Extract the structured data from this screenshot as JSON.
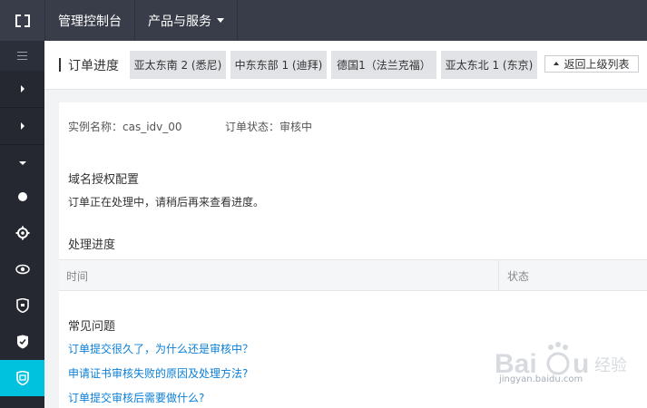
{
  "topbar": {
    "console_label": "管理控制台",
    "products_label": "产品与服务"
  },
  "sidebar": {
    "icons": [
      "menu-icon",
      "chevron-right-icon",
      "chevron-right-icon",
      "chevron-down-icon",
      "circle-icon",
      "gear-icon",
      "eye-icon",
      "shield-icon",
      "shield-check-icon",
      "certificate-icon"
    ],
    "active_color": "#00c1de"
  },
  "header": {
    "title": "订单进度",
    "region_tabs": [
      {
        "label": "亚太东南 2 (悉尼)"
      },
      {
        "label": "中东东部 1 (迪拜)"
      },
      {
        "label": "德国1（法兰克福）"
      },
      {
        "label": "亚太东北 1 (东京)"
      }
    ],
    "back_label": "返回上级列表"
  },
  "panel": {
    "instance_text": "实例名称：cas_idv_00",
    "status_text": "订单状态：审核中",
    "domain_section_title": "域名授权配置",
    "processing_message": "订单正在处理中，请稍后再来查看进度。",
    "progress_section_title": "处理进度",
    "table": {
      "headers": [
        "时间",
        "状态"
      ]
    },
    "faq_title": "常见问题",
    "faq_links": [
      "订单提交很久了，为什么还是审核中？",
      "申请证书审核失败的原因及处理方法?",
      "订单提交审核后需要做什么?"
    ]
  },
  "watermark": {
    "brand": "Baidu",
    "sub": "经验",
    "url": "jingyan.baidu.com"
  }
}
